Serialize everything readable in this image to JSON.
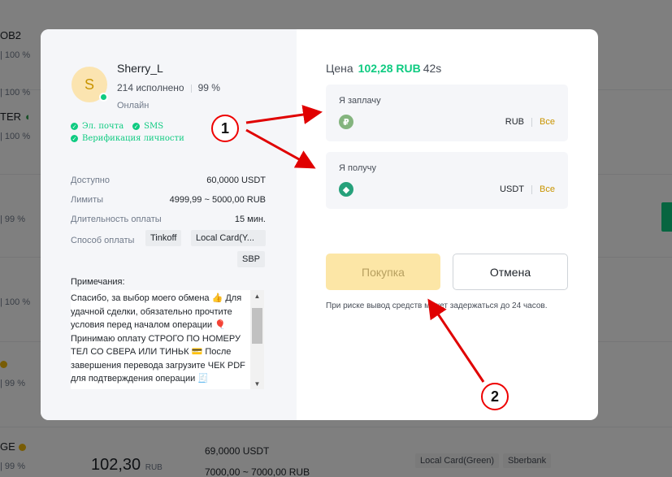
{
  "background": {
    "rows": [
      {
        "name": "OB2",
        "pct": "100 %"
      },
      {
        "name": "",
        "pct": "100 %"
      },
      {
        "name": "TER",
        "pct": "100 %"
      },
      {
        "name": "",
        "pct": "99 %"
      },
      {
        "name": "",
        "pct": "100 %"
      },
      {
        "name": "",
        "pct": "99 %"
      },
      {
        "name": "GE",
        "pct": "99 %"
      }
    ],
    "bottom_price": "102,30",
    "bottom_currency": "RUB",
    "bottom_available": "69,0000 USDT",
    "bottom_limits": "7000,00 ~ 7000,00 RUB",
    "bottom_tags": [
      "Local Card(Green)",
      "Sberbank"
    ]
  },
  "seller": {
    "avatar_letter": "S",
    "name": "Sherry_L",
    "orders": "214 исполнено",
    "completion": "99 %",
    "status": "Онлайн",
    "verifications": {
      "email": "Эл. почта",
      "sms": "SMS",
      "identity": "Верификация личности"
    }
  },
  "details": {
    "available_label": "Доступно",
    "available_value": "60,0000 USDT",
    "limits_label": "Лимиты",
    "limits_value": "4999,99 ~ 5000,00 RUB",
    "duration_label": "Длительность оплаты",
    "duration_value": "15 мин.",
    "payment_label": "Способ оплаты",
    "payment_methods": [
      "Tinkoff",
      "Local Card(Y...",
      "SBP"
    ]
  },
  "notes": {
    "label": "Примечания:",
    "text": "Спасибо, за выбор моего обмена 👍 Для удачной сделки, обязательно прочтите условия перед началом операции 🎈 Принимаю оплату СТРОГО ПО НОМЕРУ ТЕЛ СО СВЕРА ИЛИ ТИНЬК 💳 После завершения перевода загрузите ЧЕК PDF для подтверждения операции 🧾"
  },
  "order": {
    "price_label": "Цена",
    "price_value": "102,28 RUB",
    "timer": "42s",
    "pay": {
      "label": "Я заплачу",
      "currency": "RUB",
      "all": "Все"
    },
    "receive": {
      "label": "Я получу",
      "currency": "USDT",
      "all": "Все"
    },
    "buy_button": "Покупка",
    "cancel_button": "Отмена",
    "risk_note": "При риске вывод средств может задержаться до 24 часов."
  },
  "annotations": [
    "1",
    "2"
  ],
  "colors": {
    "accent_green": "#0ecb81",
    "accent_yellow": "#f0b90b",
    "annotation_red": "#e00000"
  }
}
